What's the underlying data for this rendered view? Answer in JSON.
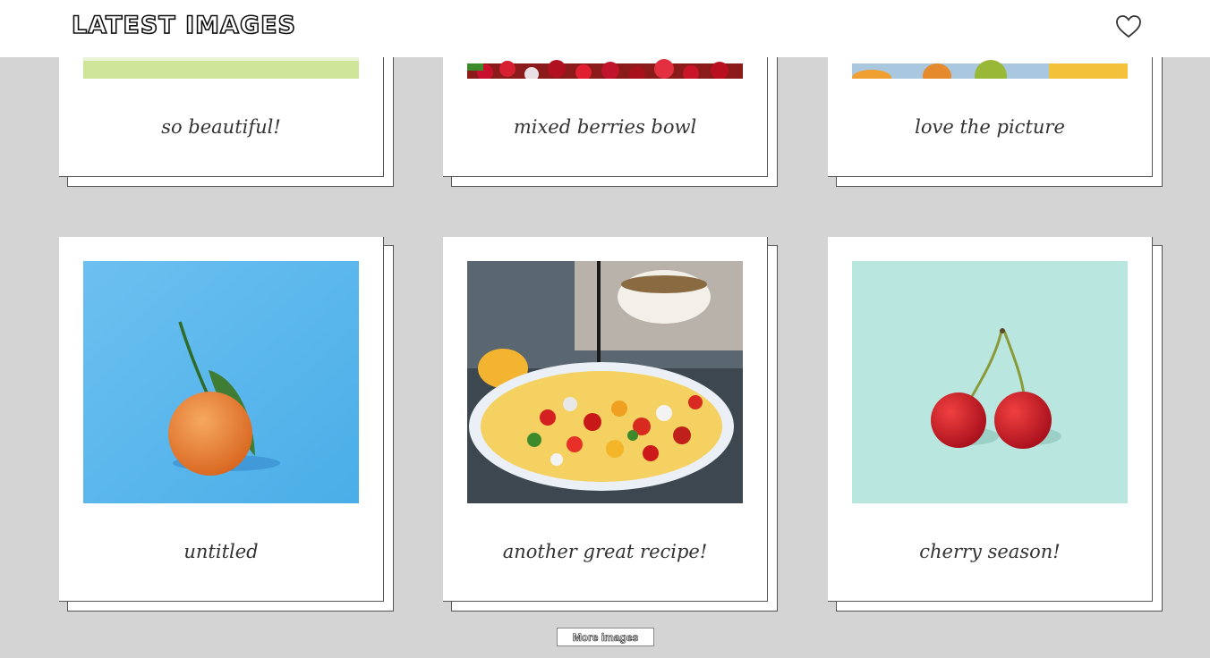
{
  "header": {
    "title": "LATEST IMAGES",
    "favorite_icon": "heart-outline-icon"
  },
  "gallery": {
    "cards": [
      {
        "caption": "so beautiful!"
      },
      {
        "caption": "mixed berries bowl"
      },
      {
        "caption": "love the picture"
      },
      {
        "caption": "untitled"
      },
      {
        "caption": "another great recipe!"
      },
      {
        "caption": "cherry season!"
      }
    ]
  },
  "footer": {
    "more_label": "More images"
  },
  "colors": {
    "background": "#d4d4d4",
    "card": "#ffffff",
    "orange_photo_bg": "#5cbcf2",
    "cherry_photo_bg": "#b8e8e0"
  }
}
